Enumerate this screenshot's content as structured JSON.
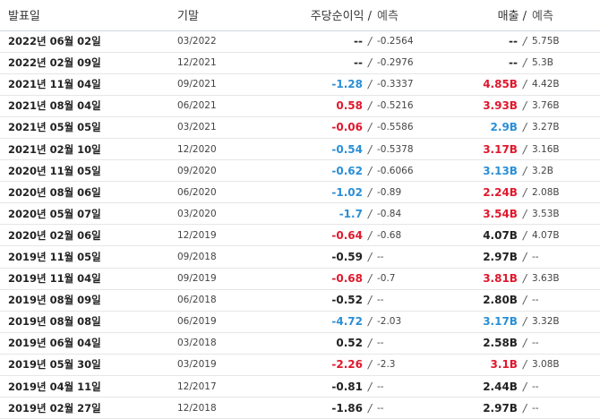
{
  "headers": {
    "date": "발표일",
    "period": "기말",
    "eps": "주당순이익 /",
    "eps_forecast": "예측",
    "revenue": "매출 /",
    "revenue_forecast": "예측"
  },
  "colors": {
    "beat": "#2a8fd6",
    "miss": "#e0182d",
    "neutral": "#222222"
  },
  "rows": [
    {
      "date": "2022년 06월 02일",
      "period": "03/2022",
      "eps": "--",
      "eps_status": "neutral",
      "eps_forecast": "-0.2564",
      "revenue": "--",
      "revenue_status": "neutral",
      "revenue_forecast": "5.75B"
    },
    {
      "date": "2022년 02월 09일",
      "period": "12/2021",
      "eps": "--",
      "eps_status": "neutral",
      "eps_forecast": "-0.2976",
      "revenue": "--",
      "revenue_status": "neutral",
      "revenue_forecast": "5.3B"
    },
    {
      "date": "2021년 11월 04일",
      "period": "09/2021",
      "eps": "-1.28",
      "eps_status": "pos",
      "eps_forecast": "-0.3337",
      "revenue": "4.85B",
      "revenue_status": "neg",
      "revenue_forecast": "4.42B"
    },
    {
      "date": "2021년 08월 04일",
      "period": "06/2021",
      "eps": "0.58",
      "eps_status": "neg",
      "eps_forecast": "-0.5216",
      "revenue": "3.93B",
      "revenue_status": "neg",
      "revenue_forecast": "3.76B"
    },
    {
      "date": "2021년 05월 05일",
      "period": "03/2021",
      "eps": "-0.06",
      "eps_status": "neg",
      "eps_forecast": "-0.5586",
      "revenue": "2.9B",
      "revenue_status": "pos",
      "revenue_forecast": "3.27B"
    },
    {
      "date": "2021년 02월 10일",
      "period": "12/2020",
      "eps": "-0.54",
      "eps_status": "pos",
      "eps_forecast": "-0.5378",
      "revenue": "3.17B",
      "revenue_status": "neg",
      "revenue_forecast": "3.16B"
    },
    {
      "date": "2020년 11월 05일",
      "period": "09/2020",
      "eps": "-0.62",
      "eps_status": "pos",
      "eps_forecast": "-0.6066",
      "revenue": "3.13B",
      "revenue_status": "pos",
      "revenue_forecast": "3.2B"
    },
    {
      "date": "2020년 08월 06일",
      "period": "06/2020",
      "eps": "-1.02",
      "eps_status": "pos",
      "eps_forecast": "-0.89",
      "revenue": "2.24B",
      "revenue_status": "neg",
      "revenue_forecast": "2.08B"
    },
    {
      "date": "2020년 05월 07일",
      "period": "03/2020",
      "eps": "-1.7",
      "eps_status": "pos",
      "eps_forecast": "-0.84",
      "revenue": "3.54B",
      "revenue_status": "neg",
      "revenue_forecast": "3.53B"
    },
    {
      "date": "2020년 02월 06일",
      "period": "12/2019",
      "eps": "-0.64",
      "eps_status": "neg",
      "eps_forecast": "-0.68",
      "revenue": "4.07B",
      "revenue_status": "neutral",
      "revenue_forecast": "4.07B"
    },
    {
      "date": "2019년 11월 05일",
      "period": "09/2018",
      "eps": "-0.59",
      "eps_status": "neutral",
      "eps_forecast": "--",
      "revenue": "2.97B",
      "revenue_status": "neutral",
      "revenue_forecast": "--"
    },
    {
      "date": "2019년 11월 04일",
      "period": "09/2019",
      "eps": "-0.68",
      "eps_status": "neg",
      "eps_forecast": "-0.7",
      "revenue": "3.81B",
      "revenue_status": "neg",
      "revenue_forecast": "3.63B"
    },
    {
      "date": "2019년 08월 09일",
      "period": "06/2018",
      "eps": "-0.52",
      "eps_status": "neutral",
      "eps_forecast": "--",
      "revenue": "2.80B",
      "revenue_status": "neutral",
      "revenue_forecast": "--"
    },
    {
      "date": "2019년 08월 08일",
      "period": "06/2019",
      "eps": "-4.72",
      "eps_status": "pos",
      "eps_forecast": "-2.03",
      "revenue": "3.17B",
      "revenue_status": "pos",
      "revenue_forecast": "3.32B"
    },
    {
      "date": "2019년 06월 04일",
      "period": "03/2018",
      "eps": "0.52",
      "eps_status": "neutral",
      "eps_forecast": "--",
      "revenue": "2.58B",
      "revenue_status": "neutral",
      "revenue_forecast": "--"
    },
    {
      "date": "2019년 05월 30일",
      "period": "03/2019",
      "eps": "-2.26",
      "eps_status": "neg",
      "eps_forecast": "-2.3",
      "revenue": "3.1B",
      "revenue_status": "neg",
      "revenue_forecast": "3.08B"
    },
    {
      "date": "2019년 04월 11일",
      "period": "12/2017",
      "eps": "-0.81",
      "eps_status": "neutral",
      "eps_forecast": "--",
      "revenue": "2.44B",
      "revenue_status": "neutral",
      "revenue_forecast": "--"
    },
    {
      "date": "2019년 02월 27일",
      "period": "12/2018",
      "eps": "-1.86",
      "eps_status": "neutral",
      "eps_forecast": "--",
      "revenue": "2.97B",
      "revenue_status": "neutral",
      "revenue_forecast": "--"
    }
  ]
}
